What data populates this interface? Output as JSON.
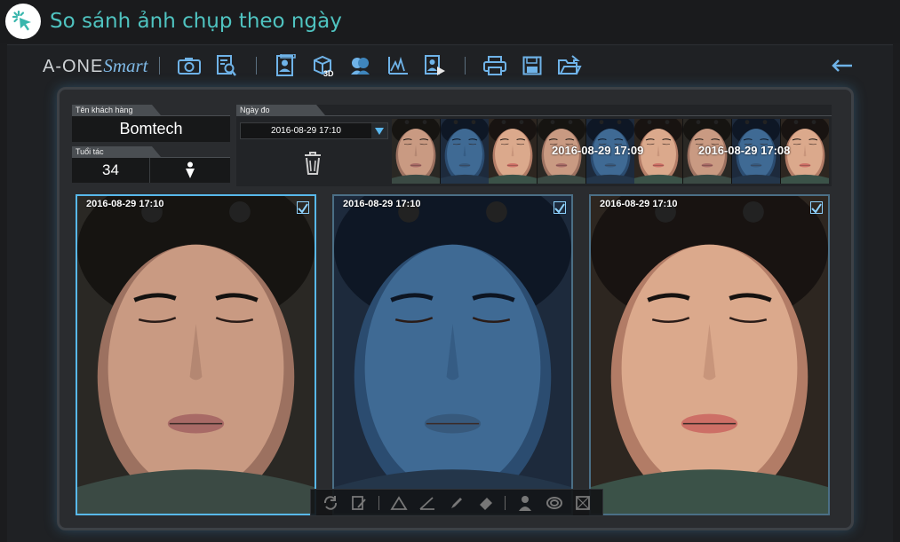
{
  "titlebar": {
    "title": "So sánh ảnh chụp theo ngày",
    "logo_icon": "cursor-click-icon",
    "accent_color": "#4fc3c0"
  },
  "toolbar": {
    "brand_main": "A-ONE",
    "brand_script": "Smart",
    "icons": [
      "camera-icon",
      "search-document-icon",
      "face-compare-icon",
      "cube-3d-icon",
      "profile-face-icon",
      "graph-icon",
      "video-export-icon",
      "printer-icon",
      "save-icon",
      "folder-open-icon"
    ],
    "back_icon": "arrow-left-icon"
  },
  "customer": {
    "name_label": "Tên khách hàng",
    "name": "Bomtech",
    "age_label": "Tuổi tác",
    "age": "34",
    "gender_icon": "male-icon"
  },
  "date": {
    "label": "Ngày đo",
    "selected": "2016-08-29 17:10",
    "delete_icon": "trash-icon"
  },
  "thumbnails": {
    "group_dates": [
      "2016-08-29 17:09",
      "2016-08-29 17:08"
    ],
    "tints": [
      "normal",
      "uv",
      "polarized",
      "normal",
      "uv",
      "polarized",
      "normal",
      "uv",
      "polarized"
    ]
  },
  "photos": [
    {
      "date": "2016-08-29 17:10",
      "mode": "normal",
      "checked": true
    },
    {
      "date": "2016-08-29 17:10",
      "mode": "uv",
      "checked": true
    },
    {
      "date": "2016-08-29 17:10",
      "mode": "polarized",
      "checked": true
    }
  ],
  "bottom_tools": [
    "rotate-icon",
    "edit-note-icon",
    "measure-triangle-icon",
    "angle-icon",
    "pencil-icon",
    "eraser-icon",
    "person-icon",
    "target-icon",
    "grid-icon"
  ],
  "colors": {
    "panel_glow": "#58b8ea",
    "selected_border": "#58b8ea"
  }
}
